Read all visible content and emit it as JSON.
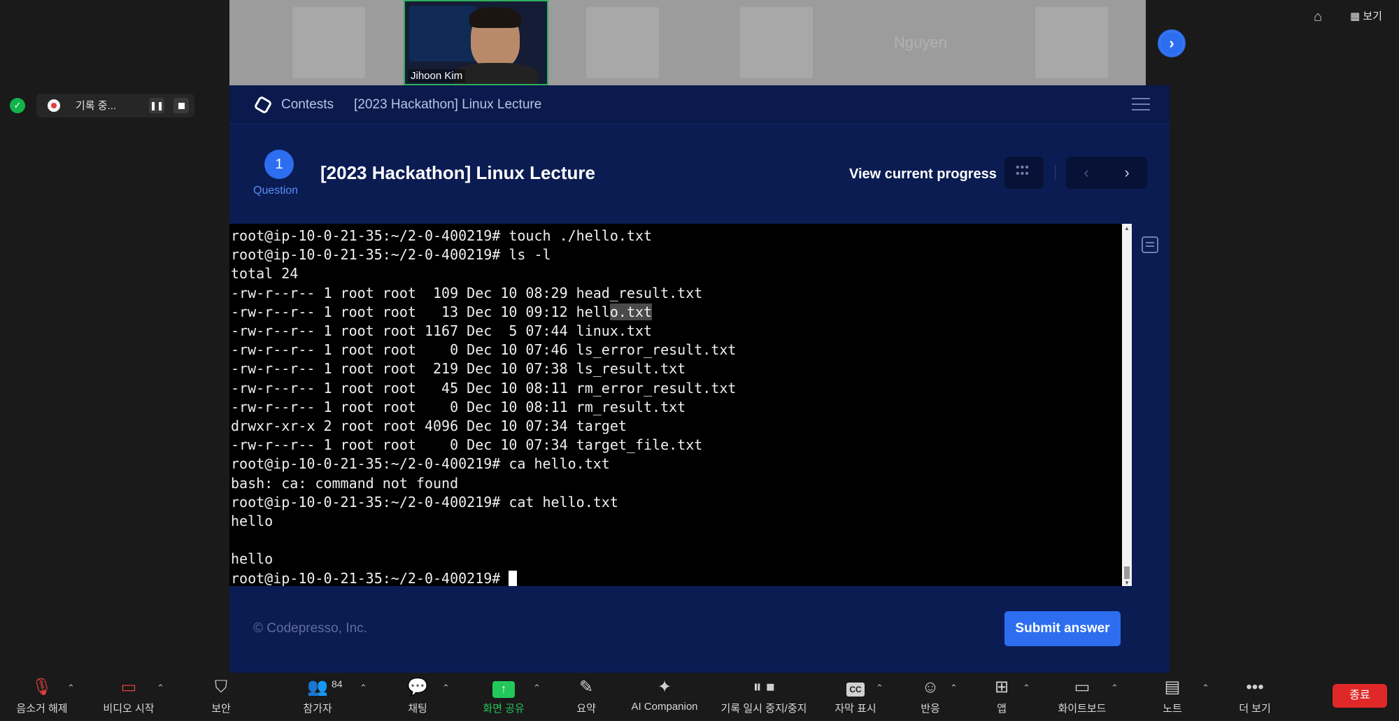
{
  "meeting": {
    "active_speaker": "Jihoon Kim",
    "ghost_name": "Nguyen",
    "view_label": "보기",
    "recording_label": "기록 중..."
  },
  "contest": {
    "breadcrumb_root": "Contests",
    "breadcrumb_page": "[2023 Hackathon] Linux Lecture",
    "question_number": "1",
    "question_label": "Question",
    "question_title": "[2023 Hackathon] Linux Lecture",
    "progress_label": "View current progress",
    "copyright": "© Codepresso, Inc.",
    "submit_label": "Submit answer"
  },
  "terminal": {
    "lines": [
      "root@ip-10-0-21-35:~/2-0-400219# touch ./hello.txt",
      "root@ip-10-0-21-35:~/2-0-400219# ls -l",
      "total 24",
      "-rw-r--r-- 1 root root  109 Dec 10 08:29 head_result.txt",
      "-rw-r--r-- 1 root root   13 Dec 10 09:12 hello.txt",
      "-rw-r--r-- 1 root root 1167 Dec  5 07:44 linux.txt",
      "-rw-r--r-- 1 root root    0 Dec 10 07:46 ls_error_result.txt",
      "-rw-r--r-- 1 root root  219 Dec 10 07:38 ls_result.txt",
      "-rw-r--r-- 1 root root   45 Dec 10 08:11 rm_error_result.txt",
      "-rw-r--r-- 1 root root    0 Dec 10 08:11 rm_result.txt",
      "drwxr-xr-x 2 root root 4096 Dec 10 07:34 target",
      "-rw-r--r-- 1 root root    0 Dec 10 07:34 target_file.txt",
      "root@ip-10-0-21-35:~/2-0-400219# ca hello.txt",
      "bash: ca: command not found",
      "root@ip-10-0-21-35:~/2-0-400219# cat hello.txt",
      "hello",
      "",
      "hello",
      "root@ip-10-0-21-35:~/2-0-400219# "
    ]
  },
  "toolbar": {
    "unmute": "음소거 해제",
    "start_video": "비디오 시작",
    "security": "보안",
    "participants": "참가자",
    "participant_count": "84",
    "chat": "채팅",
    "share_screen": "화면 공유",
    "summary": "요약",
    "ai_companion": "AI Companion",
    "recording_pause": "기록 일시 중지/중지",
    "captions": "자막 표시",
    "captions_badge": "CC",
    "reactions": "반응",
    "apps": "앱",
    "whiteboard": "화이트보드",
    "notes": "노트",
    "more": "더 보기",
    "end": "종료"
  },
  "colors": {
    "accent": "#2d6ef0",
    "panel": "#0b1c52",
    "share_green": "#23c85a",
    "end_red": "#e02828"
  }
}
